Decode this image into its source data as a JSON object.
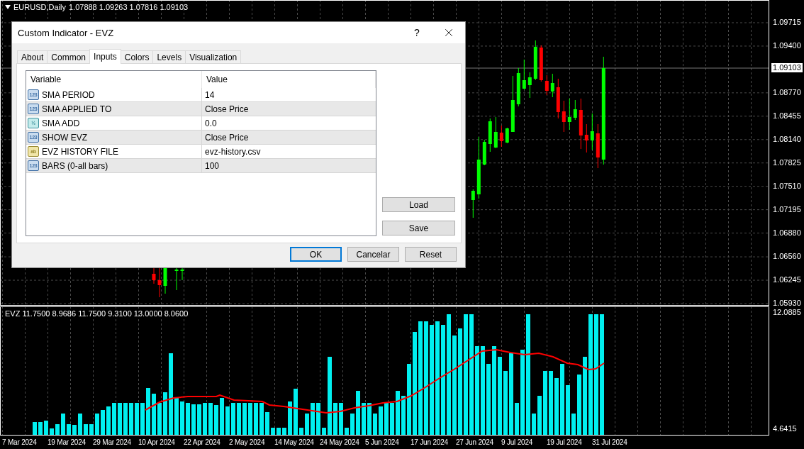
{
  "chart": {
    "symbol": "EURUSD,Daily",
    "ohlc": "1.07888 1.09263 1.07816 1.09103",
    "price_axis": [
      {
        "label": "1.09715",
        "current": false
      },
      {
        "label": "1.09400",
        "current": false
      },
      {
        "label": "1.09103",
        "current": true
      },
      {
        "label": "1.08770",
        "current": false
      },
      {
        "label": "1.08455",
        "current": false
      },
      {
        "label": "1.08140",
        "current": false
      },
      {
        "label": "1.07825",
        "current": false
      },
      {
        "label": "1.07510",
        "current": false
      },
      {
        "label": "1.07195",
        "current": false
      },
      {
        "label": "1.06880",
        "current": false
      },
      {
        "label": "1.06560",
        "current": false
      },
      {
        "label": "1.06245",
        "current": false
      },
      {
        "label": "1.05930",
        "current": false
      }
    ]
  },
  "indicator": {
    "label": "EVZ 11.7500 8.9686 11.7500 9.3100 13.0000 8.0600",
    "axis": [
      "12.0885",
      "4.6415"
    ]
  },
  "time_axis": [
    "7 Mar 2024",
    "19 Mar 2024",
    "29 Mar 2024",
    "10 Apr 2024",
    "22 Apr 2024",
    "2 May 2024",
    "14 May 2024",
    "24 May 2024",
    "5 Jun 2024",
    "17 Jun 2024",
    "27 Jun 2024",
    "9 Jul 2024",
    "19 Jul 2024",
    "31 Jul 2024"
  ],
  "dialog": {
    "title": "Custom Indicator - EVZ",
    "help": "?",
    "tabs": [
      {
        "label": "About",
        "selected": false
      },
      {
        "label": "Common",
        "selected": false
      },
      {
        "label": "Inputs",
        "selected": true
      },
      {
        "label": "Colors",
        "selected": false
      },
      {
        "label": "Levels",
        "selected": false
      },
      {
        "label": "Visualization",
        "selected": false
      }
    ],
    "table": {
      "columns": [
        "Variable",
        "Value"
      ],
      "rows": [
        {
          "kind": "integer",
          "type_icon": "123",
          "variable": "SMA PERIOD",
          "value": "14"
        },
        {
          "kind": "integer",
          "type_icon": "123",
          "variable": "SMA APPLIED TO",
          "value": "Close Price"
        },
        {
          "kind": "fraction",
          "type_icon": "½",
          "variable": "SMA ADD",
          "value": "0.0"
        },
        {
          "kind": "integer",
          "type_icon": "123",
          "variable": "SHOW EVZ",
          "value": "Close Price"
        },
        {
          "kind": "text",
          "type_icon": "ab",
          "variable": "EVZ HISTORY FILE",
          "value": "evz-history.csv"
        },
        {
          "kind": "integer",
          "type_icon": "123",
          "variable": "BARS (0-all bars)",
          "value": "100"
        }
      ]
    },
    "side_buttons": [
      "Load",
      "Save"
    ],
    "buttons": [
      {
        "label": "OK",
        "default": true
      },
      {
        "label": "Cancelar",
        "default": false
      },
      {
        "label": "Reset",
        "default": false
      }
    ]
  }
}
